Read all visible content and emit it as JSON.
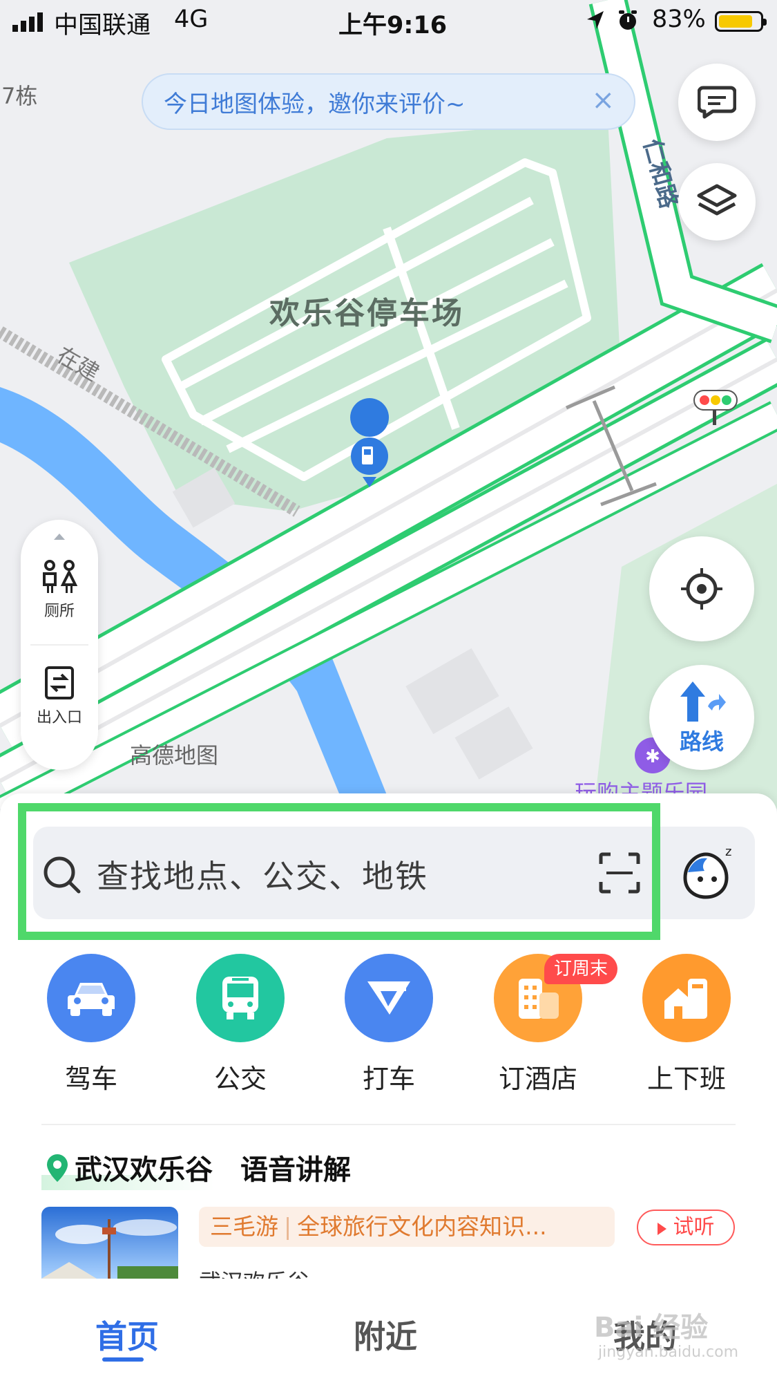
{
  "status_bar": {
    "carrier": "中国联通",
    "network": "4G",
    "time": "上午9:16",
    "battery_percent": "83%",
    "battery_level": 0.83
  },
  "banner": {
    "text": "今日地图体验，邀你来评价~",
    "close_symbol": "×"
  },
  "map": {
    "labels": {
      "parking": "欢乐谷停车场",
      "road_renhe": "仁和路",
      "under_construction": "在建",
      "building_7": "7栋",
      "watermark": "高德地图",
      "theme_park": "玩购主题乐园"
    }
  },
  "left_panel": {
    "toilet_label": "厕所",
    "entrance_label": "出入口"
  },
  "route_button": {
    "label": "路线"
  },
  "search": {
    "placeholder": "查找地点、公交、地铁"
  },
  "quick_actions": [
    {
      "label": "驾车",
      "color": "#4a86f0"
    },
    {
      "label": "公交",
      "color": "#22c7a0"
    },
    {
      "label": "打车",
      "color": "#4a86f0"
    },
    {
      "label": "订酒店",
      "color": "#ffa238",
      "badge": "订周末"
    },
    {
      "label": "上下班",
      "color": "#ff9a2e"
    }
  ],
  "poi": {
    "name": "武汉欢乐谷",
    "subtitle": "语音讲解",
    "tag_brand": "三毛游",
    "tag_text": "全球旅行文化内容知识...",
    "listen_label": "试听",
    "cut_text": "武汉欢乐谷"
  },
  "tabs": [
    {
      "label": "首页",
      "active": true
    },
    {
      "label": "附近",
      "active": false
    },
    {
      "label": "我的",
      "active": false
    }
  ],
  "watermark": {
    "main": "Bai 经验",
    "sub": "jingyan.baidu.com"
  }
}
